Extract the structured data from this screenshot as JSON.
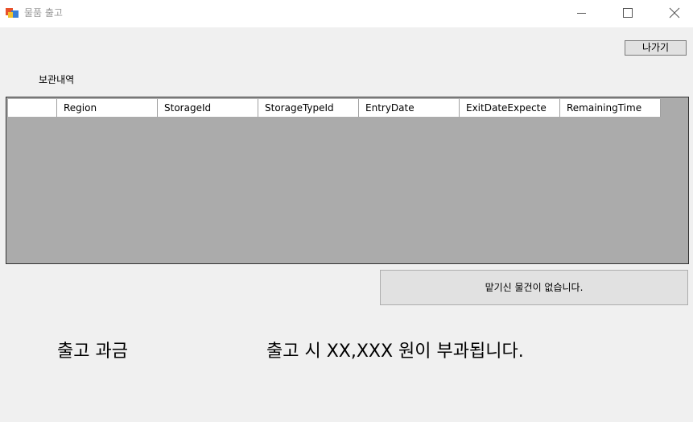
{
  "window": {
    "title": "물품 출고"
  },
  "toolbar": {
    "exit_label": "나가기"
  },
  "storage": {
    "label": "보관내역",
    "columns": [
      "Region",
      "StorageId",
      "StorageTypeId",
      "EntryDate",
      "ExitDateExpecte",
      "RemainingTime"
    ]
  },
  "status": {
    "no_items_text": "맡기신 물건이 없습니다."
  },
  "charge": {
    "label": "출고 과금",
    "message": "출고 시 XX,XXX 원이 부과됩니다."
  },
  "colors": {
    "grid_background": "#ababab",
    "window_background": "#f0f0f0"
  }
}
